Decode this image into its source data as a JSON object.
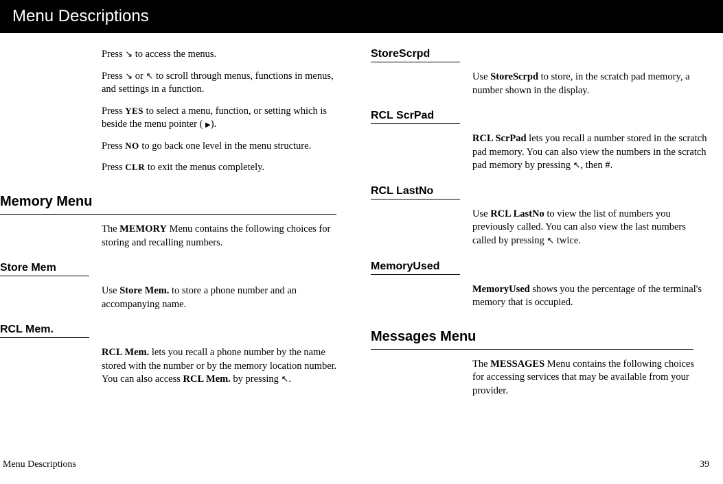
{
  "header": {
    "title": "Menu Descriptions"
  },
  "left": {
    "intro": {
      "p1_a": "Press ",
      "p1_b": " to access the menus.",
      "p2_a": "Press ",
      "p2_b": " or ",
      "p2_c": " to scroll through menus, functions in menus, and settings in a function.",
      "p3_a": "Press ",
      "p3_yes": "YES",
      "p3_b": " to select a menu, function, or setting which is beside the menu pointer ( ",
      "p3_c": ").",
      "p4_a": "Press ",
      "p4_no": "NO",
      "p4_b": " to go back one level in the menu structure.",
      "p5_a": "Press ",
      "p5_clr": "CLR",
      "p5_b": " to exit the menus completely."
    },
    "memory": {
      "h": "Memory Menu",
      "intro_a": "The ",
      "intro_b": "MEMORY",
      "intro_c": " Menu contains the following choices for storing and recalling numbers."
    },
    "storemem": {
      "h": "Store Mem",
      "p_a": "Use ",
      "p_b": "Store Mem.",
      "p_c": " to store a phone number and an accompanying name."
    },
    "rclmem": {
      "h": "RCL Mem.",
      "p_a": "RCL Mem.",
      "p_b": " lets you recall a phone number by the name stored with the number or by the memory location number.  You can also access ",
      "p_c": "RCL Mem.",
      "p_d": " by pressing ",
      "p_e": "."
    }
  },
  "right": {
    "storescrpd": {
      "h": "StoreScrpd",
      "p_a": "Use ",
      "p_b": "StoreScrpd",
      "p_c": " to store, in the scratch pad memory, a number shown in the display."
    },
    "rclscrpad": {
      "h": "RCL ScrPad",
      "p_a": "RCL ScrPad",
      "p_b": " lets you recall a number stored in the scratch pad memory.  You can also view the numbers in the scratch pad memory by pressing ",
      "p_c": ", then #."
    },
    "rcllastno": {
      "h": "RCL LastNo",
      "p_a": "Use ",
      "p_b": "RCL LastNo",
      "p_c": " to view the list of numbers you previously called.  You can also view the last numbers called by pressing ",
      "p_d": " twice."
    },
    "memoryused": {
      "h": "MemoryUsed",
      "p_a": "MemoryUsed",
      "p_b": " shows you the percentage of the terminal's memory that is occupied."
    },
    "messages": {
      "h": "Messages Menu",
      "p_a": "The ",
      "p_b": "MESSAGES",
      "p_c": " Menu contains the following choices for accessing services that may be available from your provider."
    }
  },
  "footer": {
    "left": "Menu Descriptions",
    "right": "39"
  },
  "icons": {
    "down": "↘",
    "up": "↖",
    "play": "▶"
  }
}
